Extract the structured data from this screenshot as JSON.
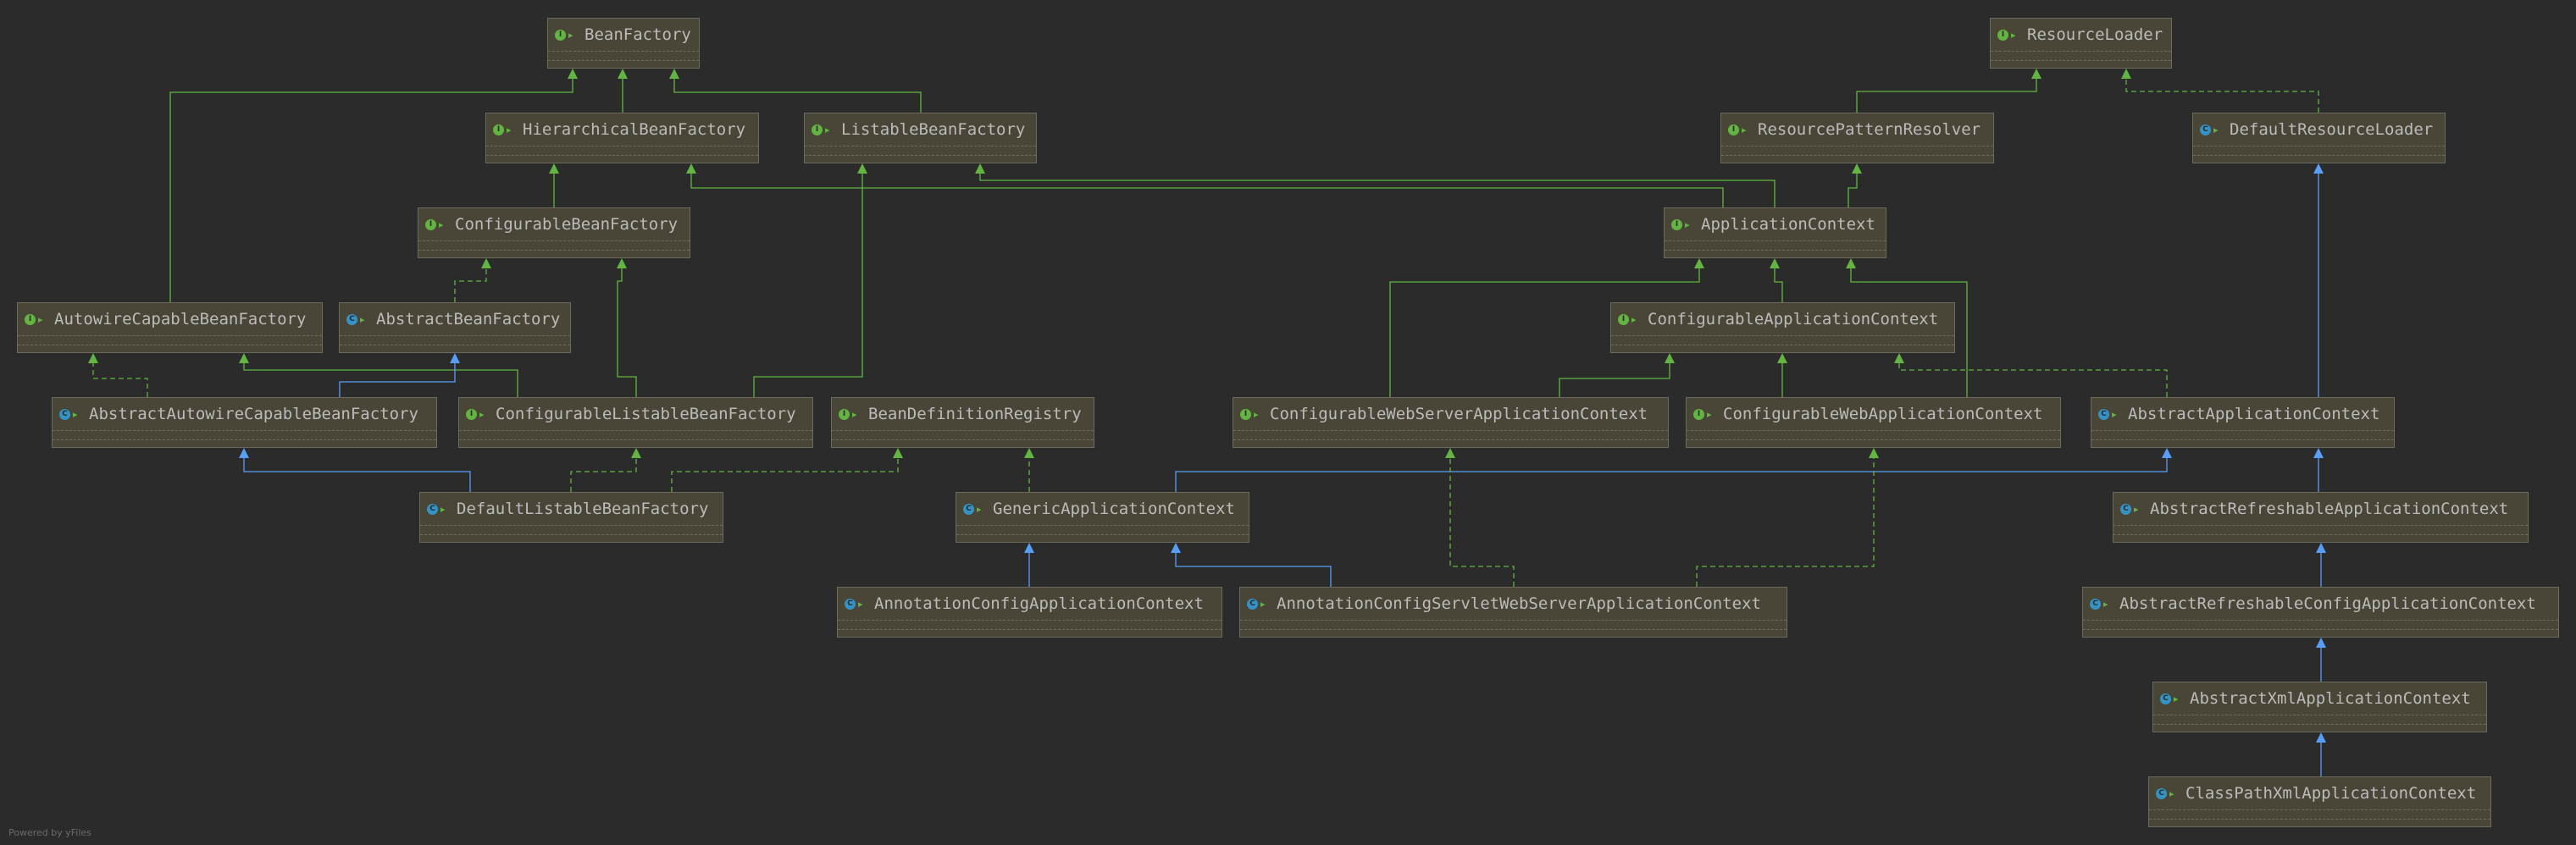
{
  "colors": {
    "interface_edge": "#62b543",
    "class_edge": "#589df6"
  },
  "footer": "Powered by yFiles",
  "nodes": [
    {
      "id": "BeanFactory",
      "label": "BeanFactory",
      "kind": "interface"
    },
    {
      "id": "ResourceLoader",
      "label": "ResourceLoader",
      "kind": "interface"
    },
    {
      "id": "HierarchicalBeanFactory",
      "label": "HierarchicalBeanFactory",
      "kind": "interface"
    },
    {
      "id": "ListableBeanFactory",
      "label": "ListableBeanFactory",
      "kind": "interface"
    },
    {
      "id": "ResourcePatternResolver",
      "label": "ResourcePatternResolver",
      "kind": "interface"
    },
    {
      "id": "DefaultResourceLoader",
      "label": "DefaultResourceLoader",
      "kind": "class"
    },
    {
      "id": "ConfigurableBeanFactory",
      "label": "ConfigurableBeanFactory",
      "kind": "interface"
    },
    {
      "id": "ApplicationContext",
      "label": "ApplicationContext",
      "kind": "interface"
    },
    {
      "id": "AutowireCapableBeanFactory",
      "label": "AutowireCapableBeanFactory",
      "kind": "interface"
    },
    {
      "id": "AbstractBeanFactory",
      "label": "AbstractBeanFactory",
      "kind": "class"
    },
    {
      "id": "ConfigurableApplicationContext",
      "label": "ConfigurableApplicationContext",
      "kind": "interface"
    },
    {
      "id": "AbstractAutowireCapableBeanFactory",
      "label": "AbstractAutowireCapableBeanFactory",
      "kind": "class"
    },
    {
      "id": "ConfigurableListableBeanFactory",
      "label": "ConfigurableListableBeanFactory",
      "kind": "interface"
    },
    {
      "id": "BeanDefinitionRegistry",
      "label": "BeanDefinitionRegistry",
      "kind": "interface"
    },
    {
      "id": "ConfigurableWebServerApplicationContext",
      "label": "ConfigurableWebServerApplicationContext",
      "kind": "interface"
    },
    {
      "id": "ConfigurableWebApplicationContext",
      "label": "ConfigurableWebApplicationContext",
      "kind": "interface"
    },
    {
      "id": "AbstractApplicationContext",
      "label": "AbstractApplicationContext",
      "kind": "class"
    },
    {
      "id": "DefaultListableBeanFactory",
      "label": "DefaultListableBeanFactory",
      "kind": "class"
    },
    {
      "id": "GenericApplicationContext",
      "label": "GenericApplicationContext",
      "kind": "class"
    },
    {
      "id": "AbstractRefreshableApplicationContext",
      "label": "AbstractRefreshableApplicationContext",
      "kind": "class"
    },
    {
      "id": "AnnotationConfigApplicationContext",
      "label": "AnnotationConfigApplicationContext",
      "kind": "class"
    },
    {
      "id": "AnnotationConfigServletWebServerApplicationContext",
      "label": "AnnotationConfigServletWebServerApplicationContext",
      "kind": "class"
    },
    {
      "id": "AbstractRefreshableConfigApplicationContext",
      "label": "AbstractRefreshableConfigApplicationContext",
      "kind": "class"
    },
    {
      "id": "AbstractXmlApplicationContext",
      "label": "AbstractXmlApplicationContext",
      "kind": "class"
    },
    {
      "id": "ClassPathXmlApplicationContext",
      "label": "ClassPathXmlApplicationContext",
      "kind": "class"
    }
  ],
  "edges": [
    {
      "from": "HierarchicalBeanFactory",
      "to": "BeanFactory",
      "type": "extends"
    },
    {
      "from": "ListableBeanFactory",
      "to": "BeanFactory",
      "type": "extends"
    },
    {
      "from": "AutowireCapableBeanFactory",
      "to": "BeanFactory",
      "type": "extends"
    },
    {
      "from": "ConfigurableBeanFactory",
      "to": "HierarchicalBeanFactory",
      "type": "extends"
    },
    {
      "from": "ApplicationContext",
      "to": "HierarchicalBeanFactory",
      "type": "extends"
    },
    {
      "from": "ApplicationContext",
      "to": "ListableBeanFactory",
      "type": "extends"
    },
    {
      "from": "ApplicationContext",
      "to": "ResourcePatternResolver",
      "type": "extends"
    },
    {
      "from": "ResourcePatternResolver",
      "to": "ResourceLoader",
      "type": "extends"
    },
    {
      "from": "DefaultResourceLoader",
      "to": "ResourceLoader",
      "type": "implements"
    },
    {
      "from": "AbstractBeanFactory",
      "to": "ConfigurableBeanFactory",
      "type": "implements"
    },
    {
      "from": "ConfigurableListableBeanFactory",
      "to": "ConfigurableBeanFactory",
      "type": "extends"
    },
    {
      "from": "ConfigurableListableBeanFactory",
      "to": "ListableBeanFactory",
      "type": "extends"
    },
    {
      "from": "ConfigurableListableBeanFactory",
      "to": "AutowireCapableBeanFactory",
      "type": "extends"
    },
    {
      "from": "AbstractAutowireCapableBeanFactory",
      "to": "AutowireCapableBeanFactory",
      "type": "implements"
    },
    {
      "from": "AbstractAutowireCapableBeanFactory",
      "to": "AbstractBeanFactory",
      "type": "extends"
    },
    {
      "from": "DefaultListableBeanFactory",
      "to": "AbstractAutowireCapableBeanFactory",
      "type": "extends"
    },
    {
      "from": "DefaultListableBeanFactory",
      "to": "ConfigurableListableBeanFactory",
      "type": "implements"
    },
    {
      "from": "DefaultListableBeanFactory",
      "to": "BeanDefinitionRegistry",
      "type": "implements"
    },
    {
      "from": "ConfigurableApplicationContext",
      "to": "ApplicationContext",
      "type": "extends"
    },
    {
      "from": "ConfigurableWebServerApplicationContext",
      "to": "ApplicationContext",
      "type": "extends"
    },
    {
      "from": "ConfigurableWebServerApplicationContext",
      "to": "ConfigurableApplicationContext",
      "type": "extends"
    },
    {
      "from": "ConfigurableWebApplicationContext",
      "to": "ConfigurableApplicationContext",
      "type": "extends"
    },
    {
      "from": "ConfigurableWebApplicationContext",
      "to": "ApplicationContext",
      "type": "extends"
    },
    {
      "from": "AbstractApplicationContext",
      "to": "ConfigurableApplicationContext",
      "type": "implements"
    },
    {
      "from": "AbstractApplicationContext",
      "to": "DefaultResourceLoader",
      "type": "extends"
    },
    {
      "from": "GenericApplicationContext",
      "to": "AbstractApplicationContext",
      "type": "extends"
    },
    {
      "from": "GenericApplicationContext",
      "to": "BeanDefinitionRegistry",
      "type": "implements"
    },
    {
      "from": "AbstractRefreshableApplicationContext",
      "to": "AbstractApplicationContext",
      "type": "extends"
    },
    {
      "from": "AnnotationConfigApplicationContext",
      "to": "GenericApplicationContext",
      "type": "extends"
    },
    {
      "from": "AnnotationConfigServletWebServerApplicationContext",
      "to": "GenericApplicationContext",
      "type": "extends"
    },
    {
      "from": "AnnotationConfigServletWebServerApplicationContext",
      "to": "ConfigurableWebServerApplicationContext",
      "type": "implements"
    },
    {
      "from": "AnnotationConfigServletWebServerApplicationContext",
      "to": "ConfigurableWebApplicationContext",
      "type": "implements"
    },
    {
      "from": "AbstractRefreshableConfigApplicationContext",
      "to": "AbstractRefreshableApplicationContext",
      "type": "extends"
    },
    {
      "from": "AbstractXmlApplicationContext",
      "to": "AbstractRefreshableConfigApplicationContext",
      "type": "extends"
    },
    {
      "from": "ClassPathXmlApplicationContext",
      "to": "AbstractXmlApplicationContext",
      "type": "extends"
    }
  ]
}
